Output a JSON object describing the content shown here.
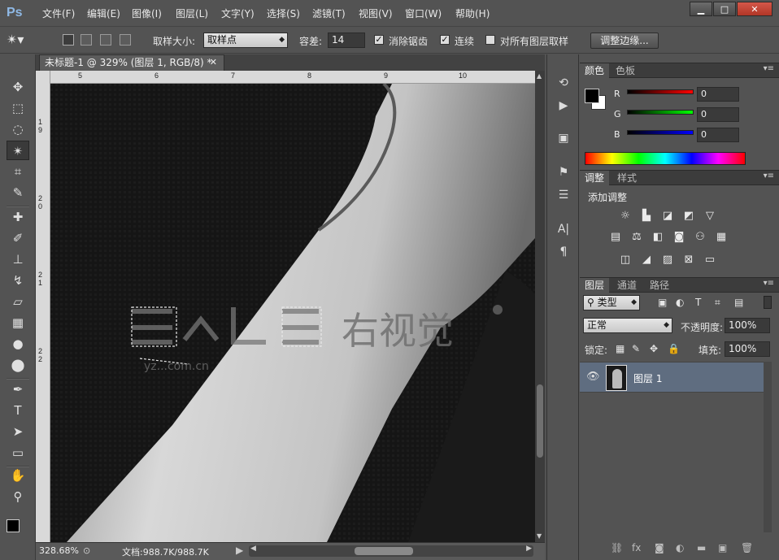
{
  "app": {
    "logo": "Ps"
  },
  "menu": [
    "文件(F)",
    "编辑(E)",
    "图像(I)",
    "图层(L)",
    "文字(Y)",
    "选择(S)",
    "滤镜(T)",
    "视图(V)",
    "窗口(W)",
    "帮助(H)"
  ],
  "window_controls": {
    "minimize": "▁",
    "maximize": "□",
    "close": "✕"
  },
  "options": {
    "sample_size_label": "取样大小:",
    "sample_size_value": "取样点",
    "tolerance_label": "容差:",
    "tolerance_value": "14",
    "antialias_label": "消除锯齿",
    "antialias_checked": "✓",
    "contiguous_label": "连续",
    "contiguous_checked": "✓",
    "all_layers_label": "对所有图层取样",
    "refine_edge_label": "调整边缘..."
  },
  "document": {
    "tab_title": "未标题-1 @ 329% (图层 1, RGB/8) *",
    "tab_close": "✕",
    "ruler_top_labels": [
      "5",
      "6",
      "7",
      "8",
      "9",
      "10"
    ],
    "ruler_left_labels": [
      "1 9",
      "2 0",
      "2 1",
      "2 2"
    ],
    "watermark_text": "右视觉",
    "watermark_small": "yz...com.cn"
  },
  "status": {
    "zoom": "328.68%",
    "doc_size": "文档:988.7K/988.7K"
  },
  "color_panel": {
    "tabs": [
      "颜色",
      "色板"
    ],
    "channels": [
      {
        "label": "R",
        "value": "0",
        "gradient_end": "#ff0000"
      },
      {
        "label": "G",
        "value": "0",
        "gradient_end": "#00ff00"
      },
      {
        "label": "B",
        "value": "0",
        "gradient_end": "#0000ff"
      }
    ]
  },
  "adjust_panel": {
    "tabs": [
      "调整",
      "样式"
    ],
    "add_adjustment": "添加调整"
  },
  "layers_panel": {
    "tabs": [
      "图层",
      "通道",
      "路径"
    ],
    "filter_label": "类型",
    "blend_mode": "正常",
    "opacity_label": "不透明度:",
    "opacity_value": "100%",
    "lock_label": "锁定:",
    "fill_label": "填充:",
    "fill_value": "100%",
    "layer_name": "图层 1"
  }
}
